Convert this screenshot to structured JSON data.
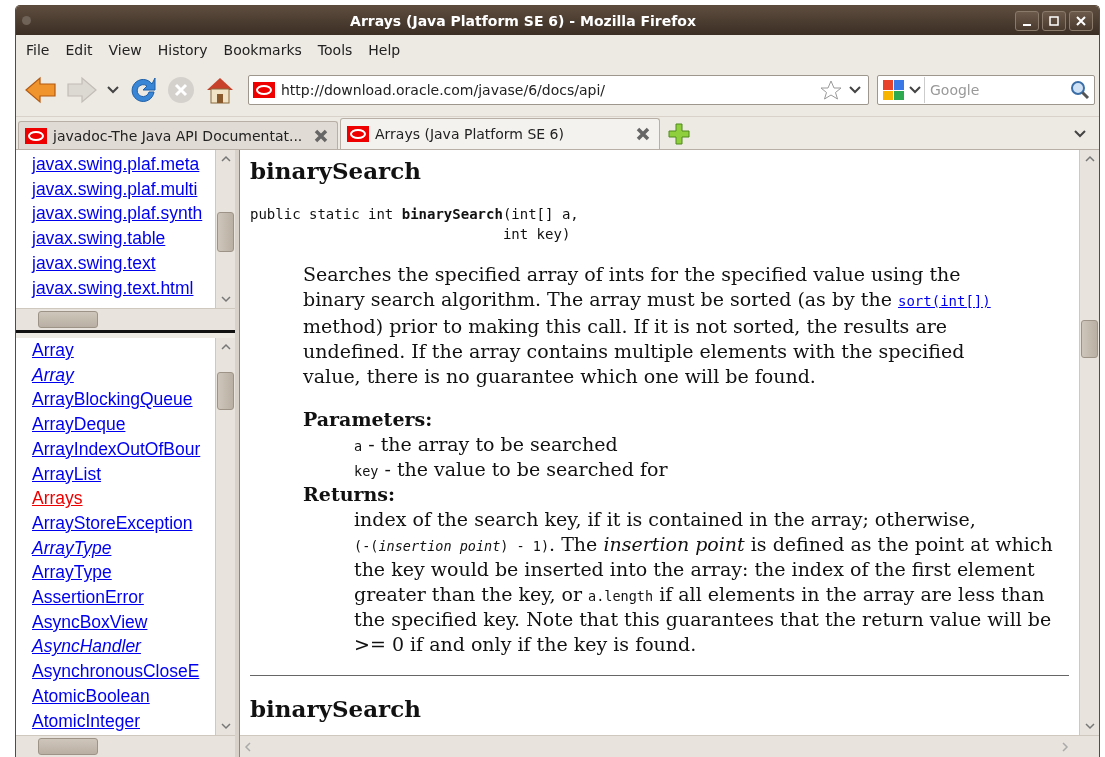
{
  "window": {
    "title": "Arrays (Java Platform SE 6) - Mozilla Firefox"
  },
  "menu": [
    "File",
    "Edit",
    "View",
    "History",
    "Bookmarks",
    "Tools",
    "Help"
  ],
  "toolbar": {
    "url": "http://download.oracle.com/javase/6/docs/api/",
    "search": {
      "placeholder": "Google"
    }
  },
  "tabs": [
    {
      "label": "javadoc-The Java API Documentat...",
      "selected": false
    },
    {
      "label": "Arrays (Java Platform SE 6)",
      "selected": true
    }
  ],
  "packages": [
    "javax.swing.plaf.meta",
    "javax.swing.plaf.multi",
    "javax.swing.plaf.synth",
    "javax.swing.table",
    "javax.swing.text",
    "javax.swing.text.html"
  ],
  "classes": [
    {
      "name": "Array",
      "kind": "class",
      "selected": false
    },
    {
      "name": "Array",
      "kind": "interface",
      "selected": false
    },
    {
      "name": "ArrayBlockingQueue",
      "kind": "class",
      "selected": false
    },
    {
      "name": "ArrayDeque",
      "kind": "class",
      "selected": false
    },
    {
      "name": "ArrayIndexOutOfBour",
      "kind": "class",
      "selected": false
    },
    {
      "name": "ArrayList",
      "kind": "class",
      "selected": false
    },
    {
      "name": "Arrays",
      "kind": "class",
      "selected": true
    },
    {
      "name": "ArrayStoreException",
      "kind": "class",
      "selected": false
    },
    {
      "name": "ArrayType",
      "kind": "interface",
      "selected": false
    },
    {
      "name": "ArrayType",
      "kind": "class",
      "selected": false
    },
    {
      "name": "AssertionError",
      "kind": "class",
      "selected": false
    },
    {
      "name": "AsyncBoxView",
      "kind": "class",
      "selected": false
    },
    {
      "name": "AsyncHandler",
      "kind": "interface",
      "selected": false
    },
    {
      "name": "AsynchronousCloseE",
      "kind": "class",
      "selected": false
    },
    {
      "name": "AtomicBoolean",
      "kind": "class",
      "selected": false
    },
    {
      "name": "AtomicInteger",
      "kind": "class",
      "selected": false
    }
  ],
  "doc": {
    "heading": "binarySearch",
    "signature": {
      "prefix": "public static int ",
      "name": "binarySearch",
      "line_1": "(int[] a,",
      "line_2": "int key)"
    },
    "description": {
      "before": "Searches the specified array of ints for the specified value using the binary search algorithm. The array must be sorted (as by the ",
      "link": "sort(int[])",
      "after": " method) prior to making this call. If it is not sorted, the results are undefined. If the array contains multiple elements with the specified value, there is no guarantee which one will be found."
    },
    "parameters_label": "Parameters:",
    "parameters": [
      {
        "name": "a",
        "text": " - the array to be searched"
      },
      {
        "name": "key",
        "text": " - the value to be searched for"
      }
    ],
    "returns_label": "Returns:",
    "returns": [
      {
        "kind": "text",
        "text": "index of the search key, if it is contained in the array; otherwise, "
      },
      {
        "kind": "code",
        "text": "(-(*insertion point*) - 1)"
      },
      {
        "kind": "text",
        "text": ". The *insertion point* is defined as the point at which the key would be inserted into the array: the index of the first element greater than the key, or "
      },
      {
        "kind": "code",
        "text": "a.length"
      },
      {
        "kind": "text",
        "text": " if all elements in the array are less than the specified key. Note that this guarantees that the return value will be >= 0 if and only if the key is found."
      }
    ],
    "next_heading": "binarySearch"
  }
}
